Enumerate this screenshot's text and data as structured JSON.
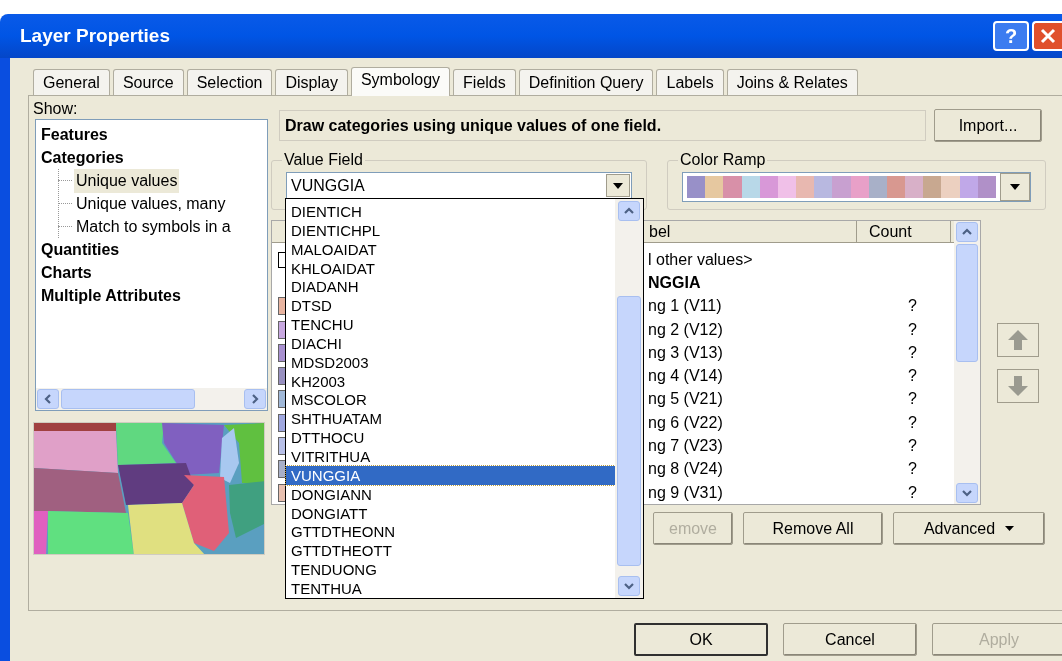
{
  "window": {
    "title": "Layer Properties",
    "help_button": "?"
  },
  "tabs": [
    {
      "label": "General",
      "selected": false
    },
    {
      "label": "Source",
      "selected": false
    },
    {
      "label": "Selection",
      "selected": false
    },
    {
      "label": "Display",
      "selected": false
    },
    {
      "label": "Symbology",
      "selected": true
    },
    {
      "label": "Fields",
      "selected": false
    },
    {
      "label": "Definition Query",
      "selected": false
    },
    {
      "label": "Labels",
      "selected": false
    },
    {
      "label": "Joins & Relates",
      "selected": false
    }
  ],
  "show_label": "Show:",
  "tree": [
    {
      "label": "Features",
      "selected": false
    },
    {
      "label": "Categories",
      "selected": false,
      "children": [
        {
          "label": "Unique values",
          "selected": true
        },
        {
          "label": "Unique values, many",
          "selected": false
        },
        {
          "label": "Match to symbols in a",
          "selected": false
        }
      ]
    },
    {
      "label": "Quantities",
      "selected": false
    },
    {
      "label": "Charts",
      "selected": false
    },
    {
      "label": "Multiple Attributes",
      "selected": false
    }
  ],
  "description": "Draw categories using unique values of one field.",
  "import_button": "Import...",
  "value_field": {
    "label": "Value Field",
    "value": "VUNGGIA",
    "options": [
      {
        "label": "DIENTICH",
        "selected": false
      },
      {
        "label": "DIENTICHPL",
        "selected": false
      },
      {
        "label": "MALOAIDAT",
        "selected": false
      },
      {
        "label": "KHLOAIDAT",
        "selected": false
      },
      {
        "label": "DIADANH",
        "selected": false
      },
      {
        "label": "DTSD",
        "selected": false
      },
      {
        "label": "TENCHU",
        "selected": false
      },
      {
        "label": "DIACHI",
        "selected": false
      },
      {
        "label": "MDSD2003",
        "selected": false
      },
      {
        "label": "KH2003",
        "selected": false
      },
      {
        "label": "MSCOLOR",
        "selected": false
      },
      {
        "label": "SHTHUATAM",
        "selected": false
      },
      {
        "label": "DTTHOCU",
        "selected": false
      },
      {
        "label": "VITRITHUA",
        "selected": false
      },
      {
        "label": "VUNGGIA",
        "selected": true
      },
      {
        "label": "DONGIANN",
        "selected": false
      },
      {
        "label": "DONGIATT",
        "selected": false
      },
      {
        "label": "GTTDTHEONN",
        "selected": false
      },
      {
        "label": "GTTDTHEOTT",
        "selected": false
      },
      {
        "label": "TENDUONG",
        "selected": false
      },
      {
        "label": "TENTHUA",
        "selected": false
      }
    ]
  },
  "color_ramp": {
    "label": "Color Ramp"
  },
  "table": {
    "columns": [
      "bel",
      "Count"
    ],
    "rows": [
      {
        "kind": "other",
        "label": "l other values>"
      },
      {
        "kind": "heading",
        "label": "NGGIA"
      },
      {
        "kind": "value",
        "color": "#e8b4a0",
        "label": "ng 1 (V11)",
        "count": "?"
      },
      {
        "kind": "value",
        "color": "#c8a8e0",
        "label": "ng 2 (V12)",
        "count": "?"
      },
      {
        "kind": "value",
        "color": "#a890d0",
        "label": "ng 3 (V13)",
        "count": "?"
      },
      {
        "kind": "value",
        "color": "#9890c0",
        "label": "ng 4 (V14)",
        "count": "?"
      },
      {
        "kind": "value",
        "color": "#a0b8d8",
        "label": "ng 5 (V21)",
        "count": "?"
      },
      {
        "kind": "value",
        "color": "#a0a8e0",
        "label": "ng 6 (V22)",
        "count": "?"
      },
      {
        "kind": "value",
        "color": "#b8c0e8",
        "label": "ng 7 (V23)",
        "count": "?"
      },
      {
        "kind": "value",
        "color": "#a8b0c8",
        "label": "ng 8 (V24)",
        "count": "?"
      },
      {
        "kind": "value",
        "color": "#e8c0b0",
        "label": "ng 9 (V31)",
        "count": "?"
      }
    ]
  },
  "buttons": [
    {
      "label": "emove",
      "disabled": true,
      "kind": "plain"
    },
    {
      "label": "Remove All",
      "disabled": false,
      "kind": "plain"
    },
    {
      "label": "Advanced",
      "disabled": false,
      "kind": "menu"
    }
  ],
  "dialog_buttons": [
    {
      "label": "OK",
      "default": true,
      "disabled": false
    },
    {
      "label": "Cancel",
      "default": false,
      "disabled": false
    },
    {
      "label": "Apply",
      "default": false,
      "disabled": true
    }
  ]
}
